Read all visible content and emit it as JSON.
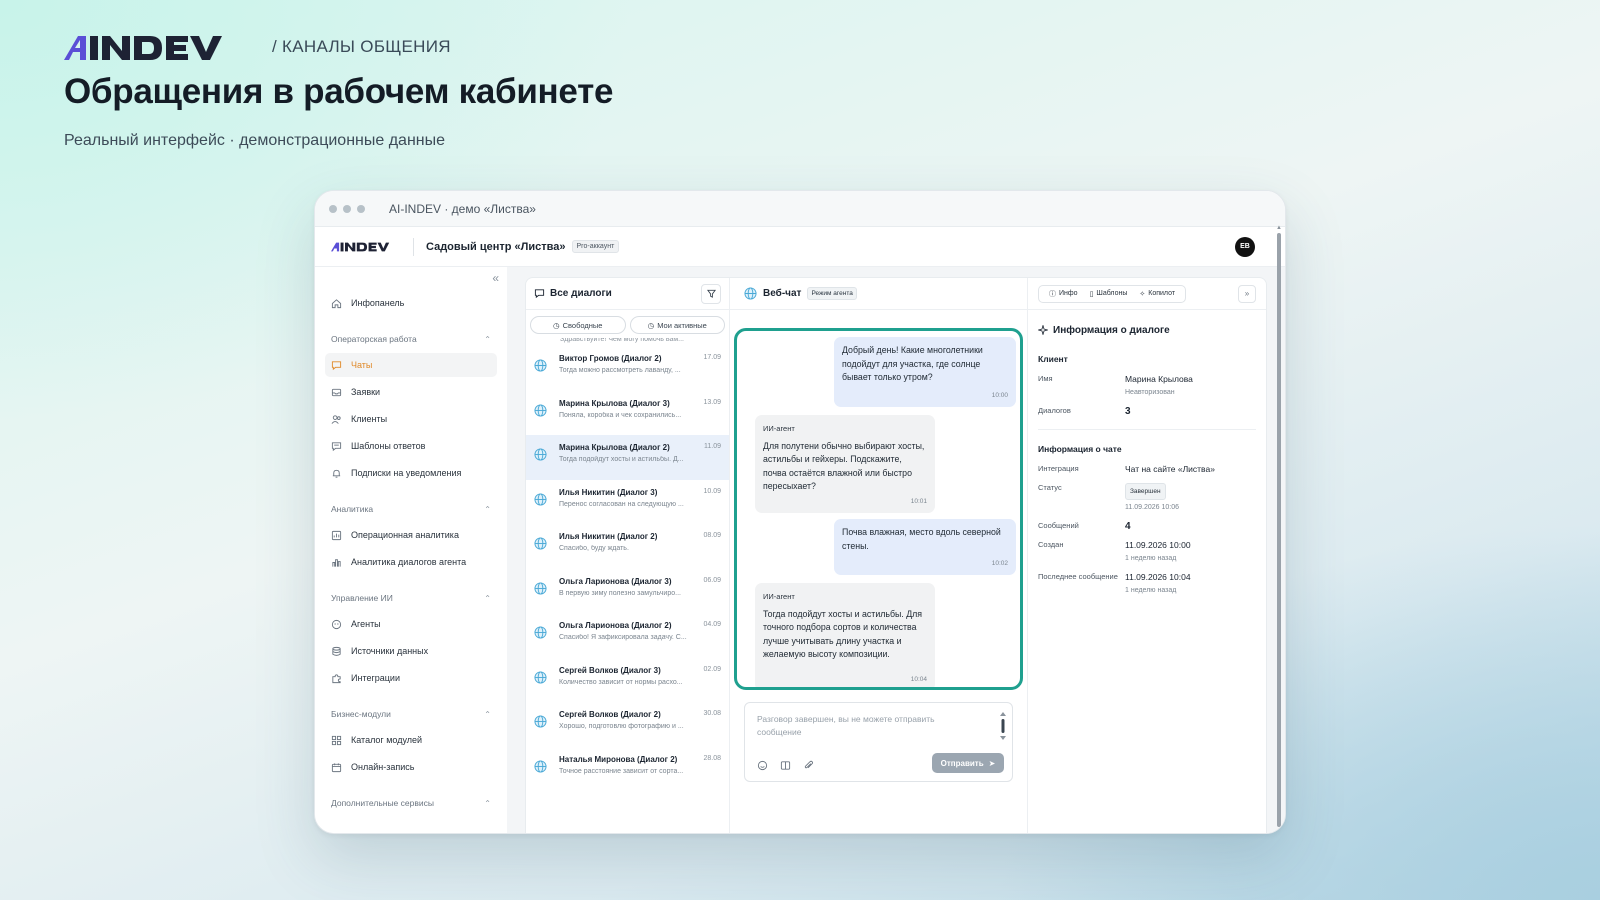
{
  "header": {
    "channel": "/ КАНАЛЫ ОБЩЕНИЯ",
    "title": "Обращения в рабочем кабинете",
    "subtitle": "Реальный интерфейс · демонстрационные данные"
  },
  "window": {
    "title": "AI-INDEV · демо «Листва»"
  },
  "appbar": {
    "org": "Садовый центр «Листва»",
    "badge": "Pro-аккаунт",
    "avatar": "ЕВ"
  },
  "sidebar": {
    "top": [
      {
        "label": "Инфопанель",
        "icon": "home-icon"
      }
    ],
    "sections": [
      {
        "title": "Операторская работа",
        "items": [
          {
            "label": "Чаты",
            "icon": "chat-icon",
            "active": true
          },
          {
            "label": "Заявки",
            "icon": "inbox-icon"
          },
          {
            "label": "Клиенты",
            "icon": "users-icon"
          },
          {
            "label": "Шаблоны ответов",
            "icon": "template-icon"
          },
          {
            "label": "Подписки на уведомления",
            "icon": "bell-icon"
          }
        ]
      },
      {
        "title": "Аналитика",
        "items": [
          {
            "label": "Операционная аналитика",
            "icon": "analytics-icon"
          },
          {
            "label": "Аналитика диалогов агента",
            "icon": "bar-chart-icon"
          }
        ]
      },
      {
        "title": "Управление ИИ",
        "items": [
          {
            "label": "Агенты",
            "icon": "agent-icon"
          },
          {
            "label": "Источники данных",
            "icon": "database-icon"
          },
          {
            "label": "Интеграции",
            "icon": "puzzle-icon"
          }
        ]
      },
      {
        "title": "Бизнес-модули",
        "items": [
          {
            "label": "Каталог модулей",
            "icon": "grid-icon"
          },
          {
            "label": "Онлайн-запись",
            "icon": "calendar-icon"
          }
        ]
      },
      {
        "title": "Дополнительные сервисы",
        "items": []
      }
    ]
  },
  "dialogs": {
    "title": "Все диалоги",
    "tabs": [
      "Свободные",
      "Мои активные"
    ],
    "truncated_prev": "Здравствуйте! Чем могу помочь вам...",
    "items": [
      {
        "name": "Виктор Громов (Диалог 2)",
        "date": "17.09",
        "preview": "Тогда можно рассмотреть лаванду, ..."
      },
      {
        "name": "Марина Крылова (Диалог 3)",
        "date": "13.09",
        "preview": "Поняла, коробка и чек сохранились..."
      },
      {
        "name": "Марина Крылова (Диалог 2)",
        "date": "11.09",
        "preview": "Тогда подойдут хосты и астильбы. Д...",
        "selected": true
      },
      {
        "name": "Илья Никитин (Диалог 3)",
        "date": "10.09",
        "preview": "Перенос согласован на следующую ..."
      },
      {
        "name": "Илья Никитин (Диалог 2)",
        "date": "08.09",
        "preview": "Спасибо, буду ждать."
      },
      {
        "name": "Ольга Ларионова (Диалог 3)",
        "date": "06.09",
        "preview": "В первую зиму полезно замульчиро..."
      },
      {
        "name": "Ольга Ларионова (Диалог 2)",
        "date": "04.09",
        "preview": "Спасибо! Я зафиксировала задачу. С..."
      },
      {
        "name": "Сергей Волков (Диалог 3)",
        "date": "02.09",
        "preview": "Количество зависит от нормы расхо..."
      },
      {
        "name": "Сергей Волков (Диалог 2)",
        "date": "30.08",
        "preview": "Хорошо, подготовлю фотографию и ..."
      },
      {
        "name": "Наталья Миронова (Диалог 2)",
        "date": "28.08",
        "preview": "Точное расстояние зависит от сорта..."
      }
    ]
  },
  "chat": {
    "title": "Веб-чат",
    "badge": "Режим агента",
    "messages": [
      {
        "side": "out",
        "text": "Добрый день! Какие многолетники подойдут для участка, где солнце бывает только утром?",
        "time": "10:00"
      },
      {
        "side": "in",
        "author": "ИИ-агент",
        "text": "Для полутени обычно выбирают хосты, астильбы и гейхеры. Подскажите, почва остаётся влажной или быстро пересыхает?",
        "time": "10:01"
      },
      {
        "side": "out",
        "text": "Почва влажная, место вдоль северной стены.",
        "time": "10:02"
      },
      {
        "side": "in",
        "author": "ИИ-агент",
        "text": "Тогда подойдут хосты и астильбы. Для точного подбора сортов и количества лучше учитывать длину участка и желаемую высоту композиции.",
        "time": "10:04"
      }
    ],
    "input_placeholder": "Разговор завершен, вы не можете отправить сообщение",
    "send_label": "Отправить"
  },
  "info": {
    "tabs": [
      "Инфо",
      "Шаблоны",
      "Копилот"
    ],
    "title": "Информация о диалоге",
    "client_section": "Клиент",
    "client": [
      {
        "k": "Имя",
        "v": "Марина Крылова",
        "sub": "Неавторизован"
      },
      {
        "k": "Диалогов",
        "v": "3",
        "big": true
      }
    ],
    "chat_section": "Информация о чате",
    "chat": [
      {
        "k": "Интеграция",
        "v": "Чат на сайте «Листва»"
      },
      {
        "k": "Статус",
        "chip": "Завершен",
        "sub": "11.09.2026 10:06"
      },
      {
        "k": "Сообщений",
        "v": "4",
        "big": true
      },
      {
        "k": "Создан",
        "v": "11.09.2026 10:00",
        "sub": "1 неделю назад"
      },
      {
        "k": "Последнее сообщение",
        "v": "11.09.2026 10:04",
        "sub": "1 неделю назад"
      }
    ]
  },
  "colors": {
    "accent": "#1fa08f",
    "active_nav": "#e08a2a",
    "logo": "#1e2234",
    "logo_accent": "#5a4fd6"
  }
}
